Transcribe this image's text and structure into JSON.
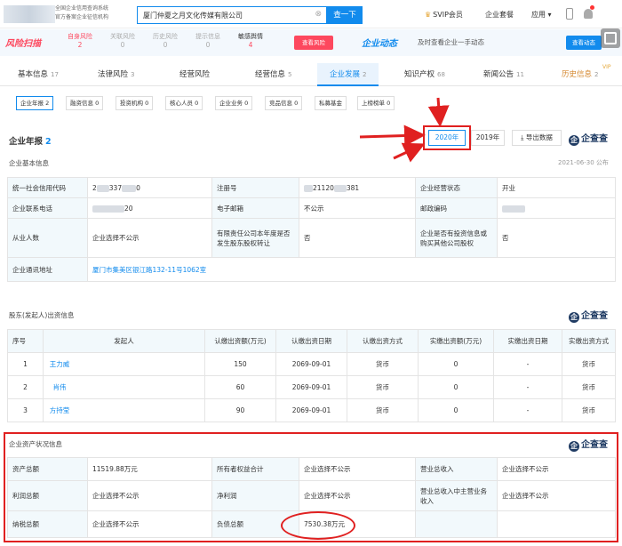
{
  "header": {
    "slogan_line1": "全国企业信用查询系统",
    "slogan_line2": "官方备案企业征信机构",
    "search_value": "厦门仲夏之月文化传媒有限公司",
    "search_button": "查一下",
    "svip_label": "SVIP会员",
    "nav_items": [
      "企业套餐",
      "应用"
    ]
  },
  "risk_bar": {
    "logo": "风险扫描",
    "items": [
      {
        "label": "自身风险",
        "count": "2",
        "color": "#fd485e"
      },
      {
        "label": "关联风险",
        "count": "0",
        "color": "#aaaaaa"
      },
      {
        "label": "历史风险",
        "count": "0",
        "color": "#aaaaaa"
      },
      {
        "label": "提示信息",
        "count": "0",
        "color": "#aaaaaa"
      },
      {
        "label": "敏感舆情",
        "count": "4",
        "color": "#fd485e"
      }
    ],
    "view_button": "查看风险",
    "dynamic_logo": "企业动态",
    "dynamic_text": "及时查看企业一手动态",
    "dynamic_button": "查看动态"
  },
  "tabs": [
    {
      "label": "基本信息",
      "count": "17"
    },
    {
      "label": "法律风险",
      "count": "3"
    },
    {
      "label": "经营风险",
      "count": ""
    },
    {
      "label": "经营信息",
      "count": "5"
    },
    {
      "label": "企业发展",
      "count": "2"
    },
    {
      "label": "知识产权",
      "count": "68"
    },
    {
      "label": "新闻公告",
      "count": "11"
    },
    {
      "label": "历史信息",
      "count": "2"
    }
  ],
  "vip_badge": "VIP",
  "subtabs": [
    "企业年报 2",
    "融资信息 0",
    "投资机构 0",
    "核心人员 0",
    "企业业务 0",
    "竞品信息 0",
    "私募基金",
    "上榜榜单 0"
  ],
  "annual_report": {
    "title": "企业年报",
    "count": "2",
    "years": [
      "2020年",
      "2019年"
    ],
    "export_label": "导出数据",
    "brand": "企查查",
    "basic_title": "企业基本信息",
    "publish_date": "2021-06-30 公布",
    "basic_rows": [
      [
        "统一社会信用代码",
        "2",
        "",
        "注册号",
        "",
        "",
        "企业经营状态",
        "开业"
      ],
      [
        "企业联系电话",
        "",
        "20",
        "电子邮箱",
        "不公示",
        "",
        "邮政编码",
        ""
      ],
      [
        "从业人数",
        "企业选择不公示",
        "",
        "有限责任公司本年度是否发生股东股权转让",
        "否",
        "",
        "企业是否有投资信息或购买其他公司股权",
        "否"
      ],
      [
        "企业通讯地址",
        "厦门市集美区银江路132-11号1062室"
      ]
    ],
    "credit_code_tail": "0",
    "reg_no_head": "",
    "reg_no_mid": "21120",
    "reg_no_tail": "381",
    "credit_code_mid": "337"
  },
  "shareholders": {
    "title": "股东(发起人)出资信息",
    "columns": [
      "序号",
      "发起人",
      "认缴出资额(万元)",
      "认缴出资日期",
      "认缴出资方式",
      "实缴出资额(万元)",
      "实缴出资日期",
      "实缴出资方式"
    ],
    "rows": [
      [
        "1",
        "王力威",
        "150",
        "2069-09-01",
        "货币",
        "0",
        "-",
        "货币"
      ],
      [
        "2",
        "肖伟",
        "60",
        "2069-09-01",
        "货币",
        "0",
        "-",
        "货币"
      ],
      [
        "3",
        "方持莹",
        "90",
        "2069-09-01",
        "货币",
        "0",
        "-",
        "货币"
      ]
    ]
  },
  "assets": {
    "title": "企业资产状况信息",
    "rows": [
      [
        "资产总额",
        "11519.88万元",
        "所有者权益合计",
        "企业选择不公示",
        "营业总收入",
        "企业选择不公示"
      ],
      [
        "利润总额",
        "企业选择不公示",
        "净利润",
        "企业选择不公示",
        "营业总收入中主营业务收入",
        "企业选择不公示"
      ],
      [
        "纳税总额",
        "企业选择不公示",
        "负债总额",
        "7530.38万元",
        "",
        ""
      ]
    ]
  },
  "accent_colors": {
    "primary": "#128bed",
    "risk": "#fd485e",
    "annotation": "#e02020"
  }
}
